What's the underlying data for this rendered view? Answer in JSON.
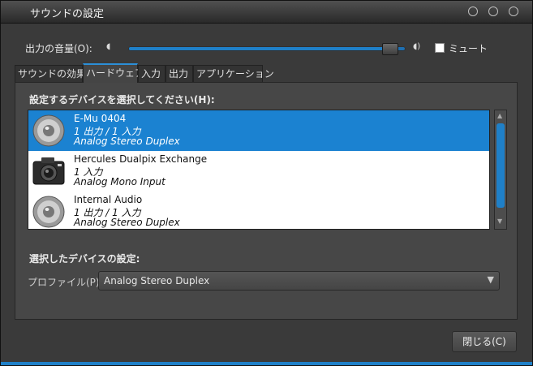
{
  "window": {
    "title": "サウンドの設定"
  },
  "volume": {
    "label": "出力の音量(O):",
    "level_percent": 97
  },
  "mute": {
    "label": "ミュート",
    "checked": false
  },
  "tabs": [
    {
      "label": "サウンドの効果"
    },
    {
      "label": "ハードウェア"
    },
    {
      "label": "入力"
    },
    {
      "label": "出力"
    },
    {
      "label": "アプリケーション"
    }
  ],
  "devices": {
    "label": "設定するデバイスを選択してください(H):",
    "items": [
      {
        "name": "E-Mu 0404",
        "channels": "1 出力 / 1 入力",
        "profile": "Analog Stereo Duplex",
        "icon": "speaker-icon",
        "selected": true
      },
      {
        "name": "Hercules Dualpix Exchange",
        "channels": "1 入力",
        "profile": "Analog Mono Input",
        "icon": "camera-icon",
        "selected": false
      },
      {
        "name": "Internal Audio",
        "channels": "1 出力 / 1 入力",
        "profile": "Analog Stereo Duplex",
        "icon": "speaker-icon",
        "selected": false
      }
    ]
  },
  "selected_settings": {
    "label": "選択したデバイスの設定:",
    "profile_label": "プロファイル(P):",
    "profile_value": "Analog Stereo Duplex"
  },
  "close_button": {
    "label": "閉じる(C)"
  },
  "colors": {
    "accent": "#1f80c8",
    "selection": "#1b82d1"
  }
}
